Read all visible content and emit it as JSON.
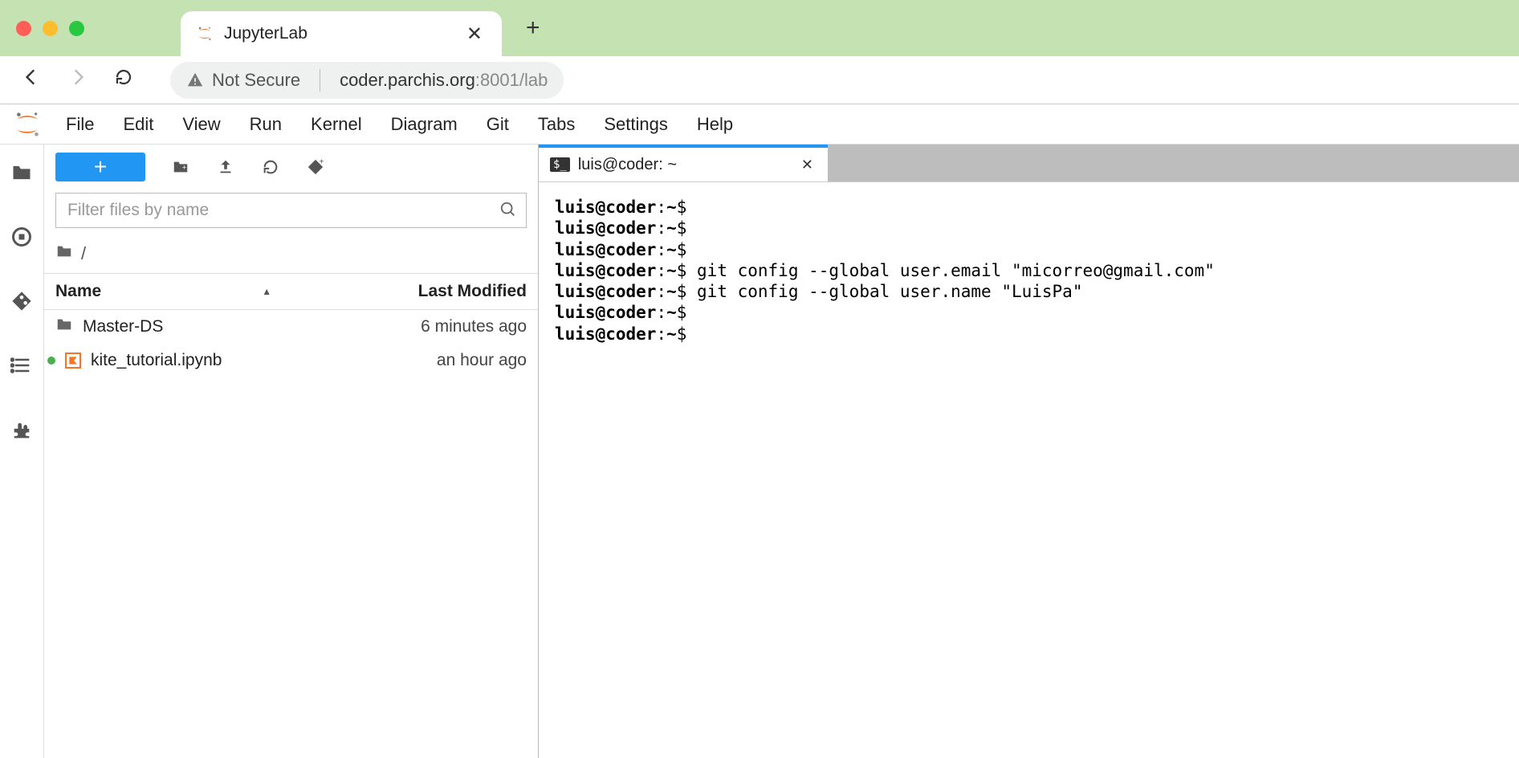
{
  "browser": {
    "tab_title": "JupyterLab",
    "not_secure_label": "Not Secure",
    "url_host": "coder.parchis.org",
    "url_path": ":8001/lab"
  },
  "menubar": {
    "items": [
      "File",
      "Edit",
      "View",
      "Run",
      "Kernel",
      "Diagram",
      "Git",
      "Tabs",
      "Settings",
      "Help"
    ]
  },
  "file_browser": {
    "filter_placeholder": "Filter files by name",
    "breadcrumb": "/",
    "columns": {
      "name": "Name",
      "modified": "Last Modified"
    },
    "rows": [
      {
        "type": "folder",
        "name": "Master-DS",
        "modified": "6 minutes ago",
        "running": false
      },
      {
        "type": "notebook",
        "name": "kite_tutorial.ipynb",
        "modified": "an hour ago",
        "running": true
      }
    ]
  },
  "workspace": {
    "tab_title": "luis@coder: ~",
    "terminal_lines": [
      {
        "prompt": "luis@coder",
        "path": "~",
        "cmd": ""
      },
      {
        "prompt": "luis@coder",
        "path": "~",
        "cmd": ""
      },
      {
        "prompt": "luis@coder",
        "path": "~",
        "cmd": ""
      },
      {
        "prompt": "luis@coder",
        "path": "~",
        "cmd": "git config --global user.email \"micorreo@gmail.com\""
      },
      {
        "prompt": "luis@coder",
        "path": "~",
        "cmd": "git config --global user.name \"LuisPa\""
      },
      {
        "prompt": "luis@coder",
        "path": "~",
        "cmd": ""
      },
      {
        "prompt": "luis@coder",
        "path": "~",
        "cmd": ""
      }
    ]
  }
}
